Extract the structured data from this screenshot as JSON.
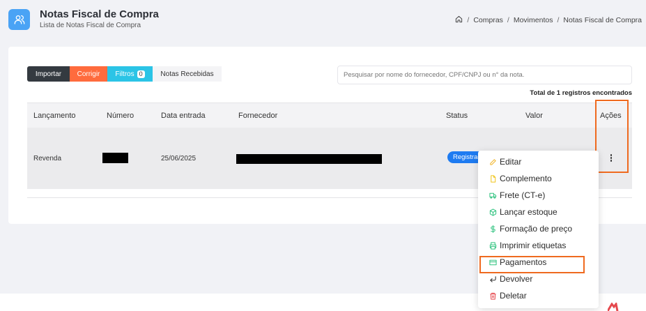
{
  "header": {
    "title": "Notas Fiscal de Compra",
    "subtitle": "Lista de Notas Fiscal de Compra",
    "breadcrumb": [
      "Compras",
      "Movimentos",
      "Notas Fiscal de Compra"
    ]
  },
  "toolbar": {
    "importar": "Importar",
    "corrigir": "Corrigir",
    "filtros": "Filtros",
    "filtros_count": "0",
    "notas_recebidas": "Notas Recebidas"
  },
  "search": {
    "placeholder": "Pesquisar por nome do fornecedor, CPF/CNPJ ou n° da nota."
  },
  "total_text": "Total de 1 registros encontrados",
  "table": {
    "columns": [
      "Lançamento",
      "Número",
      "Data entrada",
      "Fornecedor",
      "Status",
      "Valor",
      "Ações"
    ],
    "rows": [
      {
        "lancamento": "Revenda",
        "numero": "",
        "data_entrada": "25/06/2025",
        "fornecedor": "",
        "status": "Registrada",
        "valor": ""
      }
    ]
  },
  "actions_menu": {
    "items": [
      {
        "label": "Editar",
        "icon": "pencil-icon",
        "color": "#f0b429"
      },
      {
        "label": "Complemento",
        "icon": "file-icon",
        "color": "#f0c419"
      },
      {
        "label": "Frete (CT-e)",
        "icon": "truck-icon",
        "color": "#2ec27e"
      },
      {
        "label": "Lançar estoque",
        "icon": "box-icon",
        "color": "#2ec27e"
      },
      {
        "label": "Formação de preço",
        "icon": "dollar-icon",
        "color": "#2ec27e"
      },
      {
        "label": "Imprimir etiquetas",
        "icon": "printer-icon",
        "color": "#2ec27e"
      },
      {
        "label": "Pagamentos",
        "icon": "credit-card-icon",
        "color": "#2ec27e"
      },
      {
        "label": "Devolver",
        "icon": "return-arrow-icon",
        "color": "#333333"
      },
      {
        "label": "Deletar",
        "icon": "trash-icon",
        "color": "#e5484d"
      }
    ]
  },
  "colors": {
    "accent_blue": "#4aa3f5",
    "highlight_orange": "#ef6a1f",
    "status_blue": "#1e7bf1"
  }
}
